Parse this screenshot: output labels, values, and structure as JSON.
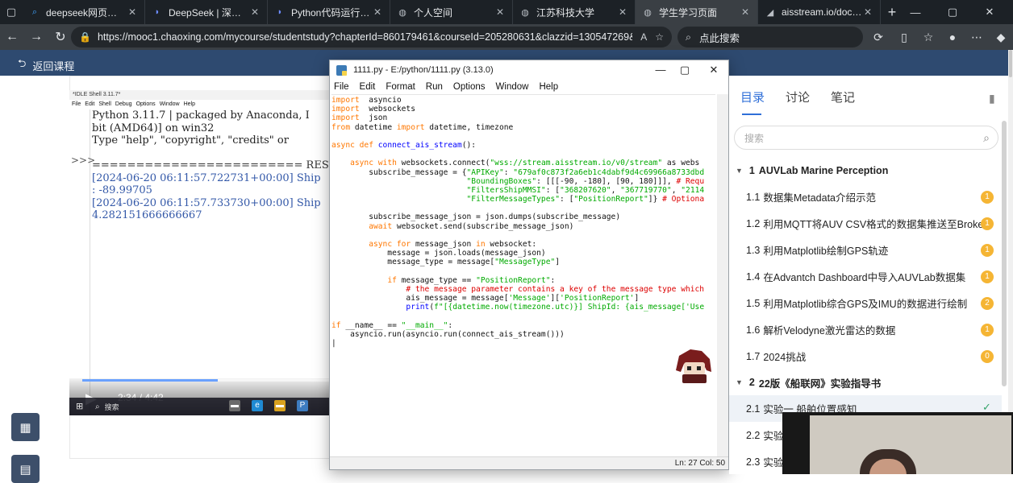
{
  "browser": {
    "tabs": [
      {
        "title": "deepseek网页版 - 搜索",
        "icon": "search-icon"
      },
      {
        "title": "DeepSeek | 深度求索",
        "icon": "deepseek-icon"
      },
      {
        "title": "Python代码运行方法详",
        "icon": "deepseek-icon"
      },
      {
        "title": "个人空间",
        "icon": "globe-icon"
      },
      {
        "title": "江苏科技大学",
        "icon": "globe-icon"
      },
      {
        "title": "学生学习页面",
        "icon": "globe-icon"
      },
      {
        "title": "aisstream.io/document",
        "icon": "aisstream-icon"
      }
    ],
    "active_tab": 5,
    "url": "https://mooc1.chaoxing.com/mycourse/studentstudy?chapterId=860179461&courseId=205280631&clazzid=130547269&cpi=3...",
    "search_placeholder": "点此搜索",
    "colors": {
      "tabstrip": "#1c2126",
      "toolbar": "#3a3f44",
      "accent": "#2f6fd8"
    }
  },
  "course": {
    "back_label": "返回课程"
  },
  "idle_shell": {
    "title": "*IDLE Shell 3.11.7*",
    "menu": [
      "File",
      "Edit",
      "Shell",
      "Debug",
      "Options",
      "Window",
      "Help"
    ],
    "prompts": [
      ">>>"
    ],
    "lines": [
      {
        "text": "Python 3.11.7 | packaged by Anaconda, I",
        "cls": ""
      },
      {
        "text": "bit (AMD64)] on win32",
        "cls": ""
      },
      {
        "text": "Type \"help\", \"copyright\", \"credits\" or",
        "cls": ""
      },
      {
        "text": "",
        "cls": ""
      },
      {
        "text": "======================== RESTART: C:/U",
        "cls": "restart"
      },
      {
        "text": "[2024-06-20 06:11:57.722731+00:00] Ship",
        "cls": "blue"
      },
      {
        "text": ": -89.99705",
        "cls": "blue"
      },
      {
        "text": "[2024-06-20 06:11:57.733730+00:00] Ship",
        "cls": "blue"
      },
      {
        "text": "4.282151666666667",
        "cls": "blue"
      }
    ]
  },
  "video": {
    "time": "2:34 / 4:42",
    "progress": 0.546,
    "taskbar_search": "搜索"
  },
  "editor": {
    "title": "1111.py - E:/python/1111.py (3.13.0)",
    "menu": [
      "File",
      "Edit",
      "Format",
      "Run",
      "Options",
      "Window",
      "Help"
    ],
    "status": "Ln: 27   Col: 50",
    "code": [
      [
        [
          "kw",
          "import"
        ],
        [
          "",
          "  asyncio"
        ]
      ],
      [
        [
          "kw",
          "import"
        ],
        [
          "",
          "  websockets"
        ]
      ],
      [
        [
          "kw",
          "import"
        ],
        [
          "",
          "  json"
        ]
      ],
      [
        [
          "kw",
          "from"
        ],
        [
          "",
          " datetime "
        ],
        [
          "kw",
          "import"
        ],
        [
          "",
          " datetime, timezone"
        ]
      ],
      [],
      [
        [
          "kw",
          "async def"
        ],
        [
          "",
          " "
        ],
        [
          "fn",
          "connect_ais_stream"
        ],
        [
          "",
          "():"
        ]
      ],
      [],
      [
        [
          "",
          "    "
        ],
        [
          "kw",
          "async with"
        ],
        [
          "",
          " websockets.connect("
        ],
        [
          "str",
          "\"wss://stream.aisstream.io/v0/stream\""
        ],
        [
          "",
          " as webs"
        ]
      ],
      [
        [
          "",
          "        subscribe_message = {"
        ],
        [
          "str",
          "\"APIKey\""
        ],
        [
          ": "
        ],
        [
          "str",
          "\"679af0c873f2a6eb1c4dabf9d4c69966a8733dbd"
        ]
      ],
      [
        [
          "",
          "                             "
        ],
        [
          "str",
          "\"BoundingBoxes\""
        ],
        [
          "",
          ": [[[-90, -180], [90, 180]]], "
        ],
        [
          "cm",
          "# Requ"
        ]
      ],
      [
        [
          "",
          "                             "
        ],
        [
          "str",
          "\"FiltersShipMMSI\""
        ],
        [
          "",
          ": ["
        ],
        [
          "str",
          "\"368207620\""
        ],
        [
          "",
          ", "
        ],
        [
          "str",
          "\"367719770\""
        ],
        [
          "",
          ", "
        ],
        [
          "str",
          "\"2114"
        ]
      ],
      [
        [
          "",
          "                             "
        ],
        [
          "str",
          "\"FilterMessageTypes\""
        ],
        [
          "",
          ": ["
        ],
        [
          "str",
          "\"PositionReport\""
        ],
        [
          "",
          "]} "
        ],
        [
          "cm",
          "# Optiona"
        ]
      ],
      [],
      [
        [
          "",
          "        subscribe_message_json = json.dumps(subscribe_message)"
        ]
      ],
      [
        [
          "",
          "        "
        ],
        [
          "kw",
          "await"
        ],
        [
          "",
          " websocket.send(subscribe_message_json)"
        ]
      ],
      [],
      [
        [
          "",
          "        "
        ],
        [
          "kw",
          "async for"
        ],
        [
          "",
          " message_json "
        ],
        [
          "kw",
          "in"
        ],
        [
          "",
          " websocket:"
        ]
      ],
      [
        [
          "",
          "            message = json.loads(message_json)"
        ]
      ],
      [
        [
          "",
          "            message_type = message["
        ],
        [
          "str",
          "\"MessageType\""
        ],
        [
          "",
          "]"
        ]
      ],
      [],
      [
        [
          "",
          "            "
        ],
        [
          "kw",
          "if"
        ],
        [
          "",
          " message_type == "
        ],
        [
          "str",
          "\"PositionReport\""
        ],
        [
          "",
          ":"
        ]
      ],
      [
        [
          "",
          "                "
        ],
        [
          "cm",
          "# the message parameter contains a key of the message type which"
        ]
      ],
      [
        [
          "",
          "                ais_message = message["
        ],
        [
          "str",
          "'Message'"
        ],
        [
          "",
          "]["
        ],
        [
          "str",
          "'PositionReport'"
        ],
        [
          "",
          "]"
        ]
      ],
      [
        [
          "",
          "                "
        ],
        [
          "fn",
          "print"
        ],
        [
          "",
          "("
        ],
        [
          "str",
          "f\"[{datetime.now(timezone.utc)}] ShipId: {ais_message['Use"
        ]
      ],
      [],
      [
        [
          "kw",
          "if"
        ],
        [
          "",
          " __name__ == "
        ],
        [
          "str",
          "\"__main__\""
        ],
        [
          "",
          ":"
        ]
      ],
      [
        [
          "",
          "    asyncio.run(asyncio.run(connect_ais_stream()))"
        ]
      ],
      [
        [
          "",
          "|"
        ]
      ]
    ]
  },
  "sidebar": {
    "tabs": [
      "目录",
      "讨论",
      "笔记"
    ],
    "active_tab": 0,
    "search_placeholder": "搜索",
    "chapters": [
      {
        "num": "1",
        "title": "AUVLab Marine Perception",
        "items": [
          {
            "num": "1.1",
            "title": "数据集Metadata介绍示范",
            "badge": "1"
          },
          {
            "num": "1.2",
            "title": "利用MQTT将AUV CSV格式的数据集推送至Broker",
            "badge": "1"
          },
          {
            "num": "1.3",
            "title": "利用Matplotlib绘制GPS轨迹",
            "badge": "1"
          },
          {
            "num": "1.4",
            "title": "在Advantch Dashboard中导入AUVLab数据集",
            "badge": "1"
          },
          {
            "num": "1.5",
            "title": "利用Matplotlib综合GPS及IMU的数据进行绘制",
            "badge": "2"
          },
          {
            "num": "1.6",
            "title": "解析Velodyne激光雷达的数据",
            "badge": "1"
          },
          {
            "num": "1.7",
            "title": "2024挑战",
            "badge": "0"
          }
        ]
      },
      {
        "num": "2",
        "title": "22版《船联网》实验指导书",
        "items": [
          {
            "num": "2.1",
            "title": "实验一 船舶位置感知",
            "badge": "",
            "current": true
          },
          {
            "num": "2.2",
            "title": "实验",
            "badge": ""
          },
          {
            "num": "2.3",
            "title": "实验",
            "badge": ""
          }
        ]
      }
    ]
  }
}
